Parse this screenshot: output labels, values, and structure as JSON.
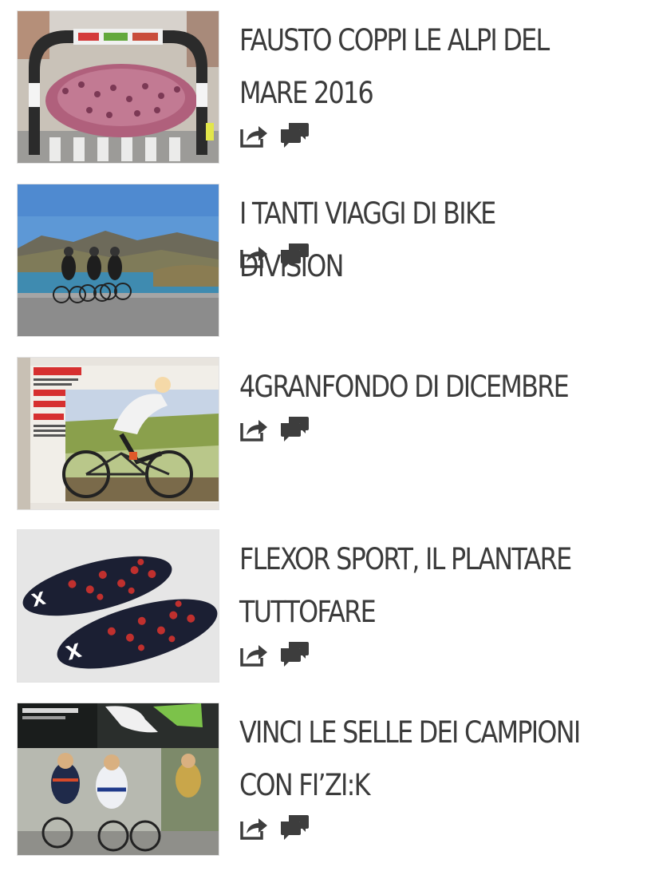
{
  "articles": [
    {
      "title": "FAUSTO COPPI LE ALPI DEL MARE 2016",
      "thumb": "thumb-finish-arch",
      "share_icon": "share-icon",
      "comments_icon": "comments-icon"
    },
    {
      "title": "I TANTI VIAGGI DI BIKE DIVISION",
      "thumb": "thumb-riders-lake",
      "share_icon": "share-icon",
      "comments_icon": "comments-icon"
    },
    {
      "title": "4GRANFONDO DI DICEMBRE",
      "thumb": "thumb-magazine-cyclist",
      "share_icon": "share-icon",
      "comments_icon": "comments-icon"
    },
    {
      "title": "FLEXOR SPORT, IL PLANTARE TUTTOFARE",
      "thumb": "thumb-insoles",
      "share_icon": "share-icon",
      "comments_icon": "comments-icon"
    },
    {
      "title": "VINCI LE SELLE DEI CAMPIONI CON FI’ZI:K",
      "thumb": "thumb-saddle-riders",
      "share_icon": "share-icon",
      "comments_icon": "comments-icon"
    }
  ],
  "colors": {
    "title_text": "#3b3b3b",
    "icon": "#3d3d3d",
    "background": "#ffffff"
  }
}
